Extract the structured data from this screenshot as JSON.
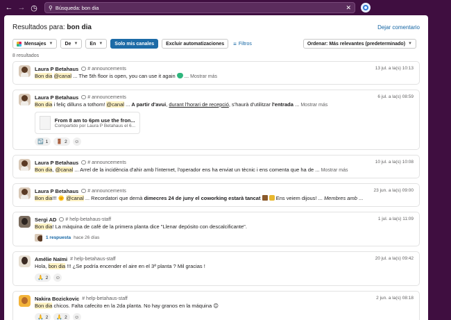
{
  "topbar": {
    "back_icon": "arrow-left-icon",
    "forward_icon": "arrow-right-icon",
    "history_icon": "clock-icon",
    "search_query": "Búsqueda: bon dia",
    "clear_icon": "close-icon",
    "help_icon": "help-icon"
  },
  "header": {
    "prefix": "Resultados para:",
    "query": "bon dia",
    "leave_comment": "Dejar comentario"
  },
  "filters": {
    "messages": "Mensajes",
    "from": "De",
    "in": "En",
    "only_my_channels": "Solo mis canales",
    "exclude_automations": "Excluir automatizaciones",
    "filters": "Filtros",
    "sort": "Ordenar: Más relevantes (predeterminado)"
  },
  "results_count": "8 resultados",
  "show_more": "Mostrar más",
  "results": [
    {
      "author": "Laura P Betahaus",
      "channel": "announcements",
      "date": "13 jul. a la(s) 10:13",
      "hl": "Bon dia",
      "mention": "@canal",
      "text": " ... The 5th floor is open, you can use it again ",
      "after": " ..."
    },
    {
      "author": "Laura P Betahaus",
      "channel": "announcements",
      "date": "6 jul. a la(s) 08:59",
      "hl": "Bon dia",
      "text1": " i feliç dilluns a tothom! ",
      "mention": "@canal",
      "text2": " ... ",
      "bold1": "A partir d'avui",
      "text3": ", ",
      "underline": "durant l'horari de recepció",
      "text4": ", s'haurà d'utilitzar ",
      "bold2": "l'entrada",
      "after": " ...",
      "attachment_title": "From 8 am to 6pm use the fron...",
      "attachment_sub": "Compartido por Laura P Betahaus el 6...",
      "reactions": [
        {
          "emoji": "↩️",
          "count": "1"
        },
        {
          "emoji": "🚪",
          "count": "2"
        }
      ]
    },
    {
      "author": "Laura P Betahaus",
      "channel": "announcements",
      "date": "10 jul. a la(s) 10:08",
      "hl": "Bon dia",
      "text1": ", ",
      "mention": "@canal",
      "text2": " ... Arrel de la incidència d'ahir amb l'internet, l'operador ens ha enviat un tècnic i ens comenta que ha de ...",
      "after": ""
    },
    {
      "author": "Laura P Betahaus",
      "channel": "announcements",
      "date": "23 jun. a la(s) 09:00",
      "hl": "Bon dia",
      "text1": "!!! 🌞 ",
      "mention": "@canal",
      "text2": " ... Recordatori que demà ",
      "bold1": "dimecres 24 de juny el coworking estarà tancat",
      "text3": " Ens veiem dijous! ... ",
      "italic": "Membres amb",
      "after": " ..."
    },
    {
      "author": "Sergi AD",
      "channel": "help-betahaus-staff",
      "date": "1 jul. a la(s) 11:09",
      "hl": "Bon dia",
      "text1": "! La màquina de café de la primera planta dice \"Llenar depósito con descalcificante\".",
      "replies": "1 respuesta",
      "ago": "hace 26 días"
    },
    {
      "author": "Amélie Naïmi",
      "channel": "help-betahaus-staff",
      "date": "20 jul. a la(s) 09:42",
      "pre": "Hola, ",
      "hl": "bon dia",
      "text1": " !!! ¿Se podría encender el aire en el 3ª planta ? Mil gracias !",
      "reactions": [
        {
          "emoji": "🙏",
          "count": "2"
        }
      ]
    },
    {
      "author": "Nakira Bozickovic",
      "channel": "help-betahaus-staff",
      "date": "2 jun. a la(s) 08:18",
      "hl": "Bon dia",
      "text1": " chicos. Falta cafecito en la 2da planta. No hay granos en la máquina 😊",
      "reactions": [
        {
          "emoji": "🙏",
          "count": "2"
        },
        {
          "emoji": "🙏",
          "count": "2"
        }
      ]
    }
  ]
}
